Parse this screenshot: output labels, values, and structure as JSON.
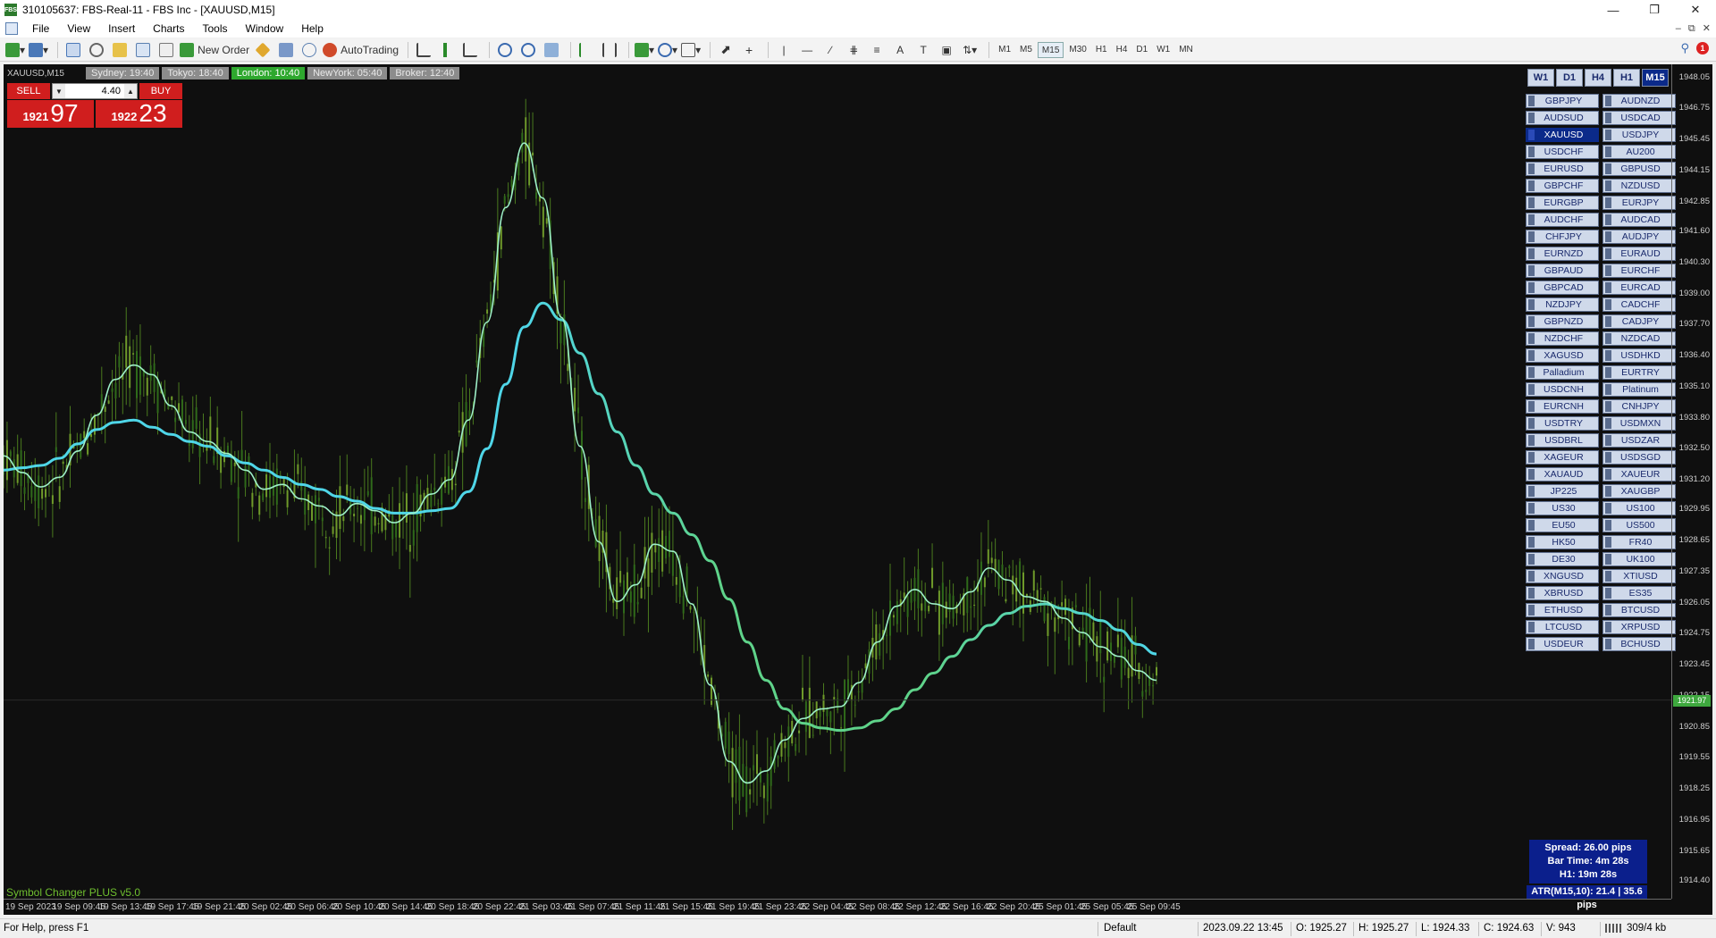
{
  "window": {
    "title": "310105637: FBS-Real-11 - FBS Inc - [XAUUSD,M15]",
    "app_icon": "FBS"
  },
  "menu": [
    "File",
    "View",
    "Insert",
    "Charts",
    "Tools",
    "Window",
    "Help"
  ],
  "toolbar": {
    "new_order_label": "New Order",
    "autotrading_label": "AutoTrading",
    "timeframes": [
      "M1",
      "M5",
      "M15",
      "M30",
      "H1",
      "H4",
      "D1",
      "W1",
      "MN"
    ],
    "active_timeframe": "M15",
    "notification_count": "1"
  },
  "chart": {
    "symbol_label": "XAUUSD,M15",
    "sessions": [
      {
        "label": "Sydney: 19:40",
        "active": false
      },
      {
        "label": "Tokyo: 18:40",
        "active": false
      },
      {
        "label": "London: 10:40",
        "active": true
      },
      {
        "label": "NewYork: 05:40",
        "active": false
      },
      {
        "label": "Broker: 12:40",
        "active": false
      }
    ],
    "trade_panel": {
      "sell_label": "SELL",
      "buy_label": "BUY",
      "lot": "4.40",
      "sell_price_prefix": "1921",
      "sell_price_big": "97",
      "buy_price_prefix": "1922",
      "buy_price_big": "23"
    },
    "tf_buttons": [
      "W1",
      "D1",
      "H4",
      "H1",
      "M15"
    ],
    "tf_active": "M15",
    "symbols": [
      "GBPJPY",
      "AUDNZD",
      "AUDSUD",
      "USDCAD",
      "XAUUSD",
      "USDJPY",
      "USDCHF",
      "AU200",
      "EURUSD",
      "GBPUSD",
      "GBPCHF",
      "NZDUSD",
      "EURGBP",
      "EURJPY",
      "AUDCHF",
      "AUDCAD",
      "CHFJPY",
      "AUDJPY",
      "EURNZD",
      "EURAUD",
      "GBPAUD",
      "EURCHF",
      "GBPCAD",
      "EURCAD",
      "NZDJPY",
      "CADCHF",
      "GBPNZD",
      "CADJPY",
      "NZDCHF",
      "NZDCAD",
      "XAGUSD",
      "USDHKD",
      "Palladium",
      "EURTRY",
      "USDCNH",
      "Platinum",
      "EURCNH",
      "CNHJPY",
      "USDTRY",
      "USDMXN",
      "USDBRL",
      "USDZAR",
      "XAGEUR",
      "USDSGD",
      "XAUAUD",
      "XAUEUR",
      "JP225",
      "XAUGBP",
      "US30",
      "US100",
      "EU50",
      "US500",
      "HK50",
      "FR40",
      "DE30",
      "UK100",
      "XNGUSD",
      "XTIUSD",
      "XBRUSD",
      "ES35",
      "ETHUSD",
      "BTCUSD",
      "LTCUSD",
      "XRPUSD",
      "USDEUR",
      "BCHUSD"
    ],
    "active_symbol": "XAUUSD",
    "info": {
      "spread": "Spread: 26.00 pips",
      "bar_time": "Bar Time: 4m 28s",
      "h1": "H1:  19m 28s",
      "atr": "ATR(M15,10): 21.4  |  35.6 pips"
    },
    "watermark": "Symbol Changer PLUS v5.0",
    "price_ticks": [
      "1948.05",
      "1946.75",
      "1945.45",
      "1944.15",
      "1942.85",
      "1941.60",
      "1940.30",
      "1939.00",
      "1937.70",
      "1936.40",
      "1935.10",
      "1933.80",
      "1932.50",
      "1931.20",
      "1929.95",
      "1928.65",
      "1927.35",
      "1926.05",
      "1924.75",
      "1923.45",
      "1922.15",
      "1920.85",
      "1919.55",
      "1918.25",
      "1916.95",
      "1915.65",
      "1914.40"
    ],
    "current_price": "1921.97",
    "time_ticks": [
      "19 Sep 2023",
      "19 Sep 09:45",
      "19 Sep 13:45",
      "19 Sep 17:45",
      "19 Sep 21:45",
      "20 Sep 02:45",
      "20 Sep 06:45",
      "20 Sep 10:45",
      "20 Sep 14:45",
      "20 Sep 18:45",
      "20 Sep 22:45",
      "21 Sep 03:45",
      "21 Sep 07:45",
      "21 Sep 11:45",
      "21 Sep 15:45",
      "21 Sep 19:45",
      "21 Sep 23:45",
      "22 Sep 04:45",
      "22 Sep 08:45",
      "22 Sep 12:45",
      "22 Sep 16:45",
      "22 Sep 20:45",
      "25 Sep 01:45",
      "25 Sep 05:45",
      "25 Sep 09:45"
    ],
    "colors": {
      "background": "#0f0f0f",
      "candles": "#4a7a1e",
      "fast_ma": "#9ef0c8",
      "slow_ma_a": "#4fd6e8",
      "slow_ma_b": "#5fd38a"
    }
  },
  "chart_data": {
    "type": "line",
    "ylim": [
      1913.8,
      1948.6
    ],
    "series": [
      {
        "values": [
          1932.2,
          1931.5,
          1930.9,
          1931.3,
          1932.4,
          1933.9,
          1935.4,
          1936.0,
          1935.6,
          1934.3,
          1933.2,
          1932.8,
          1932.3,
          1931.6,
          1930.8,
          1931.0,
          1930.4,
          1930.1,
          1929.7,
          1930.2,
          1929.9,
          1929.4,
          1929.8,
          1930.6,
          1931.2,
          1933.7,
          1937.8,
          1942.6,
          1945.3,
          1943.0,
          1938.0,
          1932.6,
          1928.6,
          1926.1,
          1926.8,
          1928.5,
          1928.2,
          1926.0,
          1922.6,
          1919.4,
          1918.5,
          1919.0,
          1920.3,
          1921.2,
          1921.6,
          1921.7,
          1922.7,
          1924.4,
          1925.9,
          1926.6,
          1926.0,
          1925.8,
          1926.5,
          1927.5,
          1927.0,
          1926.3,
          1926.1,
          1925.4,
          1924.8,
          1924.2,
          1923.8,
          1923.2,
          1922.8
        ]
      },
      {
        "values": [
          1931.6,
          1931.7,
          1931.8,
          1932.1,
          1932.7,
          1933.3,
          1933.6,
          1933.7,
          1933.4,
          1933.1,
          1932.8,
          1932.6,
          1932.2,
          1931.9,
          1931.6,
          1931.3,
          1931.0,
          1930.8,
          1930.5,
          1930.3,
          1930.0,
          1929.8,
          1929.8,
          1929.9,
          1930.0,
          1930.7,
          1932.5,
          1935.2,
          1937.6,
          1938.6,
          1937.9,
          1936.5,
          1934.8,
          1933.2,
          1931.8,
          1930.6,
          1929.8,
          1928.9,
          1927.8,
          1926.2,
          1924.4,
          1922.8,
          1921.6,
          1921.0,
          1920.8,
          1920.7,
          1920.8,
          1921.1,
          1921.6,
          1922.4,
          1923.1,
          1923.8,
          1924.5,
          1925.1,
          1925.6,
          1925.9,
          1926.0,
          1925.8,
          1925.6,
          1925.3,
          1924.9,
          1924.3,
          1923.9
        ]
      }
    ]
  },
  "status": {
    "help": "For Help, press F1",
    "profile": "Default",
    "time": "2023.09.22 13:45",
    "open": "O: 1925.27",
    "high": "H: 1925.27",
    "low": "L: 1924.33",
    "close": "C: 1924.63",
    "volume": "V: 943",
    "traffic": "309/4 kb"
  }
}
